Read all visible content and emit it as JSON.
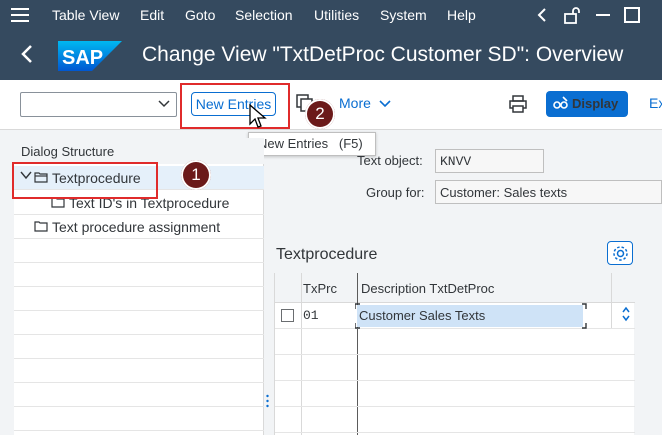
{
  "menubar": {
    "items": [
      "Table View",
      "Edit",
      "Goto",
      "Selection",
      "Utilities",
      "System",
      "Help"
    ]
  },
  "titlebar": {
    "logo_text": "SAP",
    "title": "Change View \"TxtDetProc Customer SD\": Overview"
  },
  "toolbar": {
    "new_entries_label": "New Entries",
    "more_label": "More",
    "display_label": "Display",
    "truncated_label": "Ex"
  },
  "tooltip": {
    "text": "New Entries   (F5)"
  },
  "badges": [
    "1",
    "2"
  ],
  "dialog_structure": {
    "header": "Dialog Structure",
    "items": [
      {
        "label": "Textprocedure"
      },
      {
        "label": "Text ID's in Textprocedure"
      },
      {
        "label": "Text procedure assignment"
      }
    ]
  },
  "detail": {
    "text_object_label": "Text object:",
    "text_object_value": "KNVV",
    "group_for_label": "Group for:",
    "group_for_value": "Customer: Sales texts"
  },
  "table": {
    "title": "Textprocedure",
    "columns": [
      "TxPrc",
      "Description TxtDetProc"
    ],
    "rows": [
      {
        "txprc": "01",
        "description": "Customer Sales Texts"
      }
    ]
  },
  "colors": {
    "shell": "#354a5f",
    "accent": "#0a6ed1",
    "highlight_box": "#e02b2b",
    "badge": "#6b1a1a"
  }
}
